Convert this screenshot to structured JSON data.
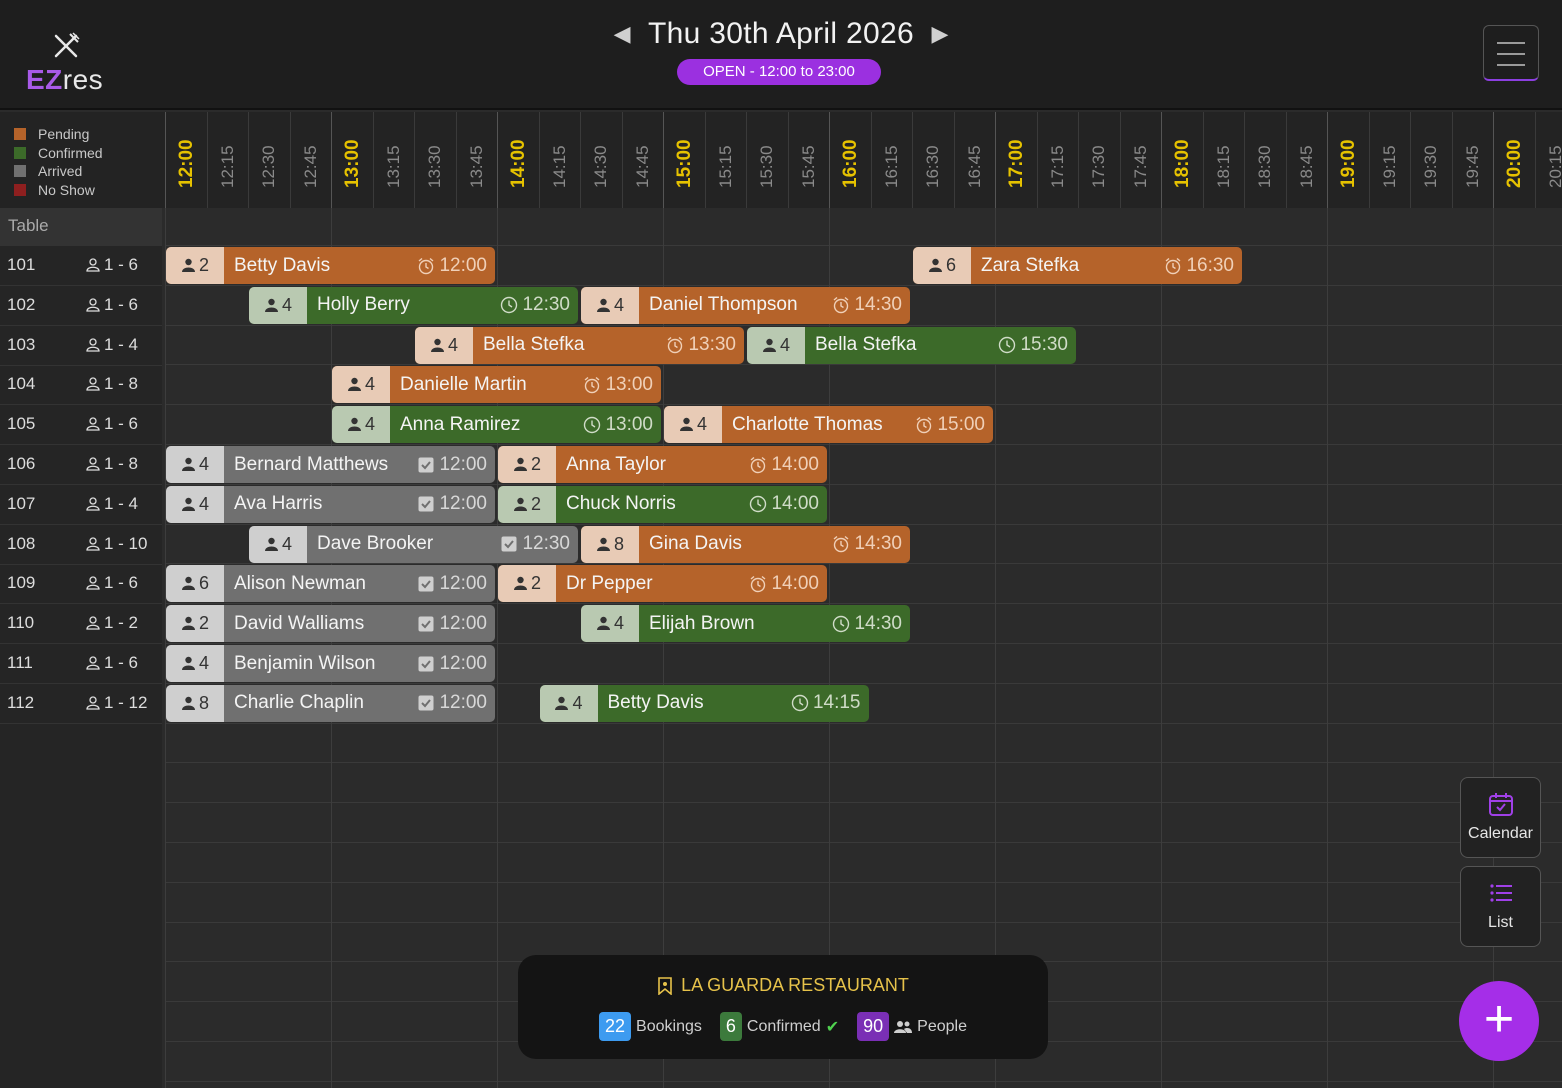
{
  "app": {
    "logo_ez": "EZ",
    "logo_res": "res"
  },
  "header": {
    "date": "Thu 30th April 2026",
    "open_badge": "OPEN - 12:00 to 23:00"
  },
  "legend": [
    {
      "label": "Pending",
      "color": "#b5632a"
    },
    {
      "label": "Confirmed",
      "color": "#3c6a29"
    },
    {
      "label": "Arrived",
      "color": "#707070"
    },
    {
      "label": "No Show",
      "color": "#8e1f1f"
    }
  ],
  "timeline": {
    "ticks": [
      "12:00",
      "12:15",
      "12:30",
      "12:45",
      "13:00",
      "13:15",
      "13:30",
      "13:45",
      "14:00",
      "14:15",
      "14:30",
      "14:45",
      "15:00",
      "15:15",
      "15:30",
      "15:45",
      "16:00",
      "16:15",
      "16:30",
      "16:45",
      "17:00",
      "17:15",
      "17:30",
      "17:45",
      "18:00",
      "18:15",
      "18:30",
      "18:45",
      "19:00",
      "19:15",
      "19:30",
      "19:45",
      "20:00",
      "20:15"
    ]
  },
  "tables": {
    "header": "Table",
    "rows": [
      {
        "num": "101",
        "cap": "1 - 6"
      },
      {
        "num": "102",
        "cap": "1 - 6"
      },
      {
        "num": "103",
        "cap": "1 - 4"
      },
      {
        "num": "104",
        "cap": "1 - 8"
      },
      {
        "num": "105",
        "cap": "1 - 6"
      },
      {
        "num": "106",
        "cap": "1 - 8"
      },
      {
        "num": "107",
        "cap": "1 - 4"
      },
      {
        "num": "108",
        "cap": "1 - 10"
      },
      {
        "num": "109",
        "cap": "1 - 6"
      },
      {
        "num": "110",
        "cap": "1 - 2"
      },
      {
        "num": "111",
        "cap": "1 - 6"
      },
      {
        "num": "112",
        "cap": "1 - 12"
      }
    ]
  },
  "bookings": [
    {
      "row": 0,
      "start": "12:00",
      "end": "14:00",
      "status": "pending",
      "pax": "2",
      "name": "Betty Davis",
      "time": "12:00"
    },
    {
      "row": 0,
      "start": "16:30",
      "end": "18:30",
      "status": "pending",
      "pax": "6",
      "name": "Zara Stefka",
      "time": "16:30"
    },
    {
      "row": 1,
      "start": "12:30",
      "end": "14:30",
      "status": "confirmed",
      "pax": "4",
      "name": "Holly Berry",
      "time": "12:30"
    },
    {
      "row": 1,
      "start": "14:30",
      "end": "16:30",
      "status": "pending",
      "pax": "4",
      "name": "Daniel Thompson",
      "time": "14:30"
    },
    {
      "row": 2,
      "start": "13:30",
      "end": "15:30",
      "status": "pending",
      "pax": "4",
      "name": "Bella Stefka",
      "time": "13:30"
    },
    {
      "row": 2,
      "start": "15:30",
      "end": "17:30",
      "status": "confirmed",
      "pax": "4",
      "name": "Bella Stefka",
      "time": "15:30"
    },
    {
      "row": 3,
      "start": "13:00",
      "end": "15:00",
      "status": "pending",
      "pax": "4",
      "name": "Danielle Martin",
      "time": "13:00"
    },
    {
      "row": 4,
      "start": "13:00",
      "end": "15:00",
      "status": "confirmed",
      "pax": "4",
      "name": "Anna Ramirez",
      "time": "13:00"
    },
    {
      "row": 4,
      "start": "15:00",
      "end": "17:00",
      "status": "pending",
      "pax": "4",
      "name": "Charlotte Thomas",
      "time": "15:00"
    },
    {
      "row": 5,
      "start": "12:00",
      "end": "14:00",
      "status": "arrived",
      "pax": "4",
      "name": "Bernard Matthews",
      "time": "12:00"
    },
    {
      "row": 5,
      "start": "14:00",
      "end": "16:00",
      "status": "pending",
      "pax": "2",
      "name": "Anna Taylor",
      "time": "14:00"
    },
    {
      "row": 6,
      "start": "12:00",
      "end": "14:00",
      "status": "arrived",
      "pax": "4",
      "name": "Ava Harris",
      "time": "12:00"
    },
    {
      "row": 6,
      "start": "14:00",
      "end": "16:00",
      "status": "confirmed",
      "pax": "2",
      "name": "Chuck Norris",
      "time": "14:00"
    },
    {
      "row": 7,
      "start": "12:30",
      "end": "14:30",
      "status": "arrived",
      "pax": "4",
      "name": "Dave Brooker",
      "time": "12:30"
    },
    {
      "row": 7,
      "start": "14:30",
      "end": "16:30",
      "status": "pending",
      "pax": "8",
      "name": "Gina Davis",
      "time": "14:30"
    },
    {
      "row": 8,
      "start": "12:00",
      "end": "14:00",
      "status": "arrived",
      "pax": "6",
      "name": "Alison Newman",
      "time": "12:00"
    },
    {
      "row": 8,
      "start": "14:00",
      "end": "16:00",
      "status": "pending",
      "pax": "2",
      "name": "Dr Pepper",
      "time": "14:00"
    },
    {
      "row": 9,
      "start": "12:00",
      "end": "14:00",
      "status": "arrived",
      "pax": "2",
      "name": "David Walliams",
      "time": "12:00"
    },
    {
      "row": 9,
      "start": "14:30",
      "end": "16:30",
      "status": "confirmed",
      "pax": "4",
      "name": "Elijah Brown",
      "time": "14:30"
    },
    {
      "row": 10,
      "start": "12:00",
      "end": "14:00",
      "status": "arrived",
      "pax": "4",
      "name": "Benjamin Wilson",
      "time": "12:00"
    },
    {
      "row": 11,
      "start": "12:00",
      "end": "14:00",
      "status": "arrived",
      "pax": "8",
      "name": "Charlie Chaplin",
      "time": "12:00"
    },
    {
      "row": 11,
      "start": "14:15",
      "end": "16:15",
      "status": "confirmed",
      "pax": "4",
      "name": "Betty Davis",
      "time": "14:15"
    }
  ],
  "summary": {
    "restaurant": "LA GUARDA RESTAURANT",
    "bookings_count": "22",
    "bookings_label": "Bookings",
    "confirmed_count": "6",
    "confirmed_label": "Confirmed",
    "people_count": "90",
    "people_label": "People",
    "colors": {
      "bookings": "#3d9bf0",
      "confirmed": "#3c7a3c",
      "people": "#7a2fb5"
    }
  },
  "side": {
    "calendar_label": "Calendar",
    "list_label": "List",
    "add_label": "+"
  }
}
